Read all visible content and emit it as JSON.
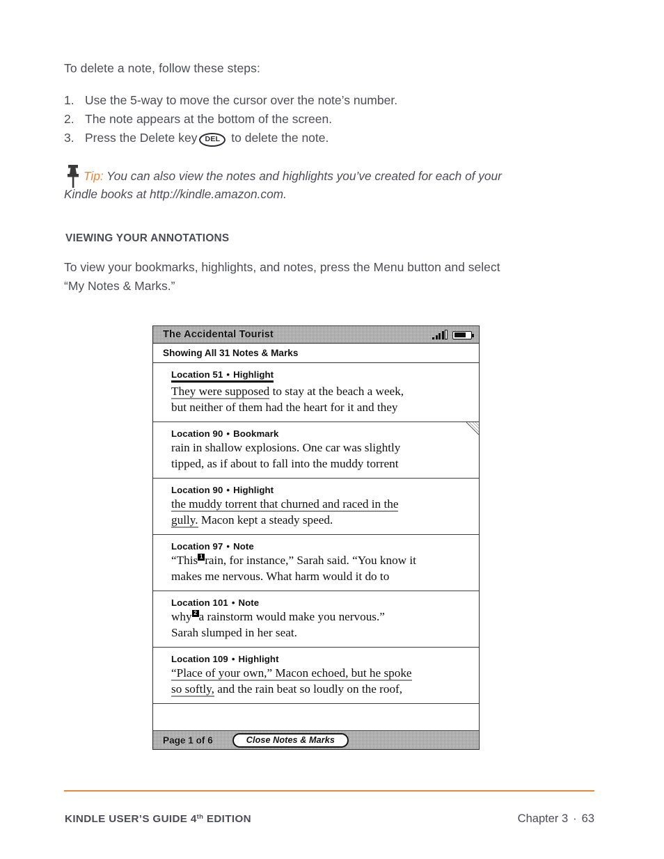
{
  "document": {
    "intro": "To delete a note, follow these steps:",
    "steps": [
      {
        "num": "1.",
        "before": "Use the 5-way to move the cursor over the note’s number.",
        "key": "",
        "after": ""
      },
      {
        "num": "2.",
        "before": "The note appears at the bottom of the screen.",
        "key": "",
        "after": ""
      },
      {
        "num": "3.",
        "before": "Press the Delete key",
        "key": "DEL",
        "after": "to delete the note."
      }
    ],
    "tip": {
      "icon": "push-pin-icon",
      "label": "Tip:",
      "line1": "You can also view the notes and highlights you’ve created for each of your",
      "line2": "Kindle books at http://kindle.amazon.com.",
      "label_color": "#e8883a"
    },
    "section": {
      "heading": "VIEWING YOUR ANNOTATIONS",
      "paragraph_line1": "To view your bookmarks, highlights, and notes, press the Menu button and select",
      "paragraph_line2": "“My Notes & Marks.”"
    }
  },
  "kindle": {
    "titlebar": {
      "title": "The Accidental Tourist",
      "signal_icon": "signal-bars-icon",
      "battery_icon": "battery-icon"
    },
    "showing_label": "Showing All 31 Notes & Marks",
    "entries": [
      {
        "location": "Location 51",
        "separator": "•",
        "type": "Highlight",
        "selected": true,
        "bookmark_fold": false,
        "highlighted_text": "They were supposed",
        "rest_line1": " to stay at the beach a week,",
        "line2": "but neither of them had the heart for it and they"
      },
      {
        "location": "Location 90",
        "separator": "•",
        "type": "Bookmark",
        "selected": false,
        "bookmark_fold": true,
        "highlighted_text": "",
        "rest_line1": "rain in shallow explosions. One car was slightly",
        "line2": "tipped, as if about to fall into the muddy torrent"
      },
      {
        "location": "Location 90",
        "separator": "•",
        "type": "Highlight",
        "selected": false,
        "bookmark_fold": false,
        "highlighted_text": "the muddy torrent that churned and raced in the",
        "rest_line1": "",
        "highlighted_text2": "gully.",
        "line2": " Macon kept a steady speed."
      },
      {
        "location": "Location 97",
        "separator": "•",
        "type": "Note",
        "selected": false,
        "bookmark_fold": false,
        "note_marker": "1",
        "pre_marker": "“This",
        "post_marker": "rain, for instance,” Sarah said. “You know it",
        "line2": "makes me nervous. What harm would it do to"
      },
      {
        "location": "Location 101",
        "separator": "•",
        "type": "Note",
        "selected": false,
        "bookmark_fold": false,
        "note_marker": "2",
        "pre_marker": "why",
        "post_marker": "a rainstorm would make you nervous.”",
        "line2": "    Sarah slumped in her seat."
      },
      {
        "location": "Location 109",
        "separator": "•",
        "type": "Highlight",
        "selected": false,
        "bookmark_fold": false,
        "highlighted_text": "“Place of your own,” Macon echoed, but he spoke",
        "rest_line1": "",
        "highlighted_text2": "so softly,",
        "line2": " and the rain beat so loudly on the roof,"
      }
    ],
    "footer": {
      "page_label": "Page 1 of 6",
      "close_button": "Close Notes & Marks"
    }
  },
  "page_footer": {
    "guide_title": "KINDLE USER’S GUIDE 4",
    "guide_title_sup": "th",
    "guide_title_end": " EDITION",
    "chapter": "Chapter 3",
    "separator": "·",
    "page_number": "63",
    "rule_color": "#e8883a"
  }
}
